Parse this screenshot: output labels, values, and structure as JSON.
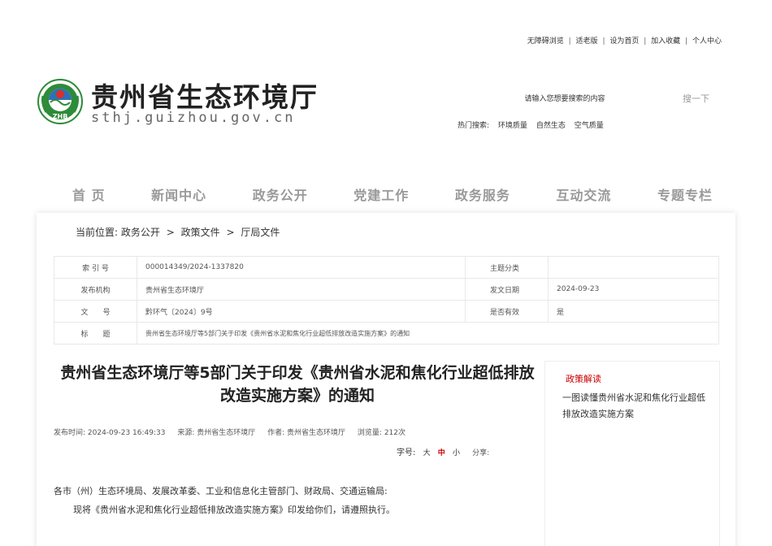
{
  "top_links": {
    "accessible": "无障碍浏览",
    "elderly": "适老版",
    "homepage": "设为首页",
    "favorite": "加入收藏",
    "personal": "个人中心"
  },
  "header": {
    "site_title": "贵州省生态环境厅",
    "site_domain": "sthj.guizhou.gov.cn",
    "logo_text": "ZHB"
  },
  "search": {
    "placeholder": "请输入您想要搜索的内容",
    "button_label": "搜一下",
    "hot_label": "热门搜索:",
    "hot_terms": [
      "环境质量",
      "自然生态",
      "空气质量"
    ]
  },
  "nav": {
    "items": [
      "首 页",
      "新闻中心",
      "政务公开",
      "党建工作",
      "政务服务",
      "互动交流",
      "专题专栏"
    ]
  },
  "breadcrumb": {
    "prefix": "当前位置:",
    "items": [
      "政务公开",
      "政策文件",
      "厅局文件"
    ],
    "sep": ">"
  },
  "meta": {
    "index_label": "索 引 号",
    "index_value": "000014349/2024-1337820",
    "topic_label": "主题分类",
    "topic_value": "",
    "org_label": "发布机构",
    "org_value": "贵州省生态环境厅",
    "date_label": "发文日期",
    "date_value": "2024-09-23",
    "docno_label": "文　　号",
    "docno_value": "黔环气〔2024〕9号",
    "valid_label": "是否有效",
    "valid_value": "是",
    "title_label": "标　　题",
    "title_value": "贵州省生态环境厅等5部门关于印发《贵州省水泥和焦化行业超低排放改造实施方案》的通知"
  },
  "article": {
    "title": "贵州省生态环境厅等5部门关于印发《贵州省水泥和焦化行业超低排放改造实施方案》的通知",
    "publish_time": "发布时间: 2024-09-23 16:49:33",
    "source": "来源: 贵州省生态环境厅",
    "author": "作者: 贵州省生态环境厅",
    "views": "浏览量: 212次",
    "font_label": "字号:",
    "font_large": "大",
    "font_medium": "中",
    "font_small": "小",
    "share_label": "分享:",
    "salutation": "各市（州）生态环境局、发展改革委、工业和信息化主管部门、财政局、交通运输局:",
    "body_line1": "现将《贵州省水泥和焦化行业超低排放改造实施方案》印发给你们，请遵照执行。"
  },
  "side_panel": {
    "title": "政策解读",
    "link": "一图读懂贵州省水泥和焦化行业超低排放改造实施方案"
  },
  "colors": {
    "accent_red": "#cc0000",
    "logo_green": "#2e8b3a",
    "nav_gray": "#999999"
  }
}
